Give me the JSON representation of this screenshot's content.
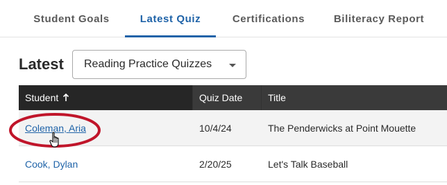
{
  "tabs": [
    {
      "label": "Student Goals"
    },
    {
      "label": "Latest Quiz",
      "active": true
    },
    {
      "label": "Certifications"
    },
    {
      "label": "Biliteracy Report"
    }
  ],
  "latest": {
    "label": "Latest",
    "dropdown_value": "Reading Practice Quizzes"
  },
  "table": {
    "headers": {
      "student": "Student",
      "quiz_date": "Quiz Date",
      "title": "Title"
    },
    "sort": "ascending",
    "rows": [
      {
        "student": "Coleman, Aria",
        "quiz_date": "10/4/24",
        "title": "The Penderwicks at Point Mouette"
      },
      {
        "student": "Cook, Dylan",
        "quiz_date": "2/20/25",
        "title": "Let's Talk Baseball"
      }
    ]
  },
  "colors": {
    "accent": "#1f63a8",
    "header_bg": "#333333",
    "highlight_ring": "#c0152a"
  }
}
